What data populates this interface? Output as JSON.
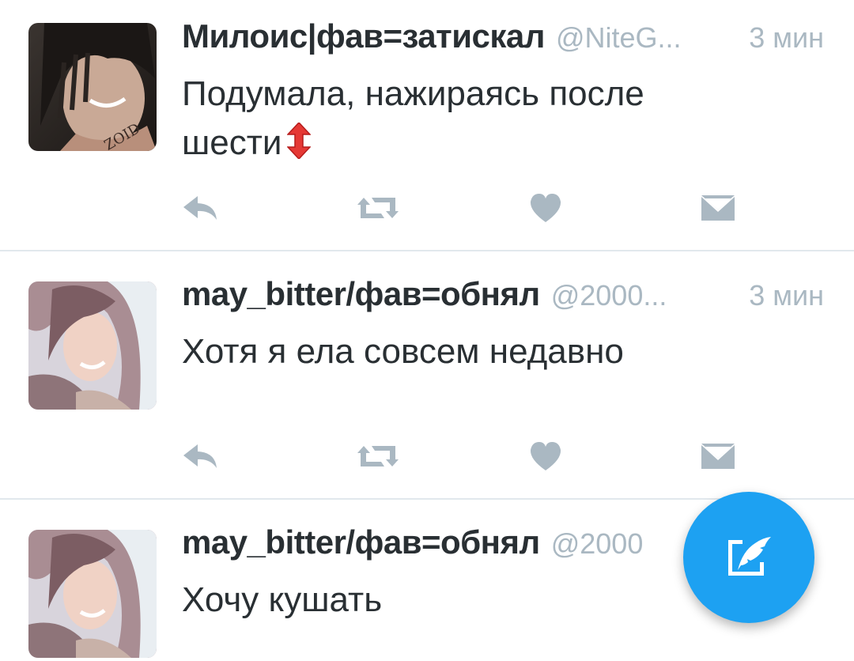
{
  "tweets": [
    {
      "display_name": "Милоис|фав=затискал",
      "handle": "@NiteG...",
      "time": "3 мин",
      "text_lines": [
        "Подумала, нажираясь после",
        "шести"
      ],
      "emoji": "up-down-arrow",
      "avatar_caption": "ZOID"
    },
    {
      "display_name": "may_bitter/фав=обнял",
      "handle": "@2000...",
      "time": "3 мин",
      "text_lines": [
        "Хотя я ела совсем недавно"
      ]
    },
    {
      "display_name": "may_bitter/фав=обнял",
      "handle": "@2000",
      "time": "",
      "text_lines": [
        "Хочу кушать"
      ]
    }
  ],
  "actions": [
    "reply-icon",
    "retweet-icon",
    "like-icon",
    "direct-message-icon"
  ],
  "fab": {
    "icon": "compose-tweet-icon"
  },
  "colors": {
    "accent": "#1da1f2",
    "text": "#292f33",
    "muted": "#aab8c2",
    "separator": "#e1e8ed",
    "emoji_red": "#e53935"
  }
}
